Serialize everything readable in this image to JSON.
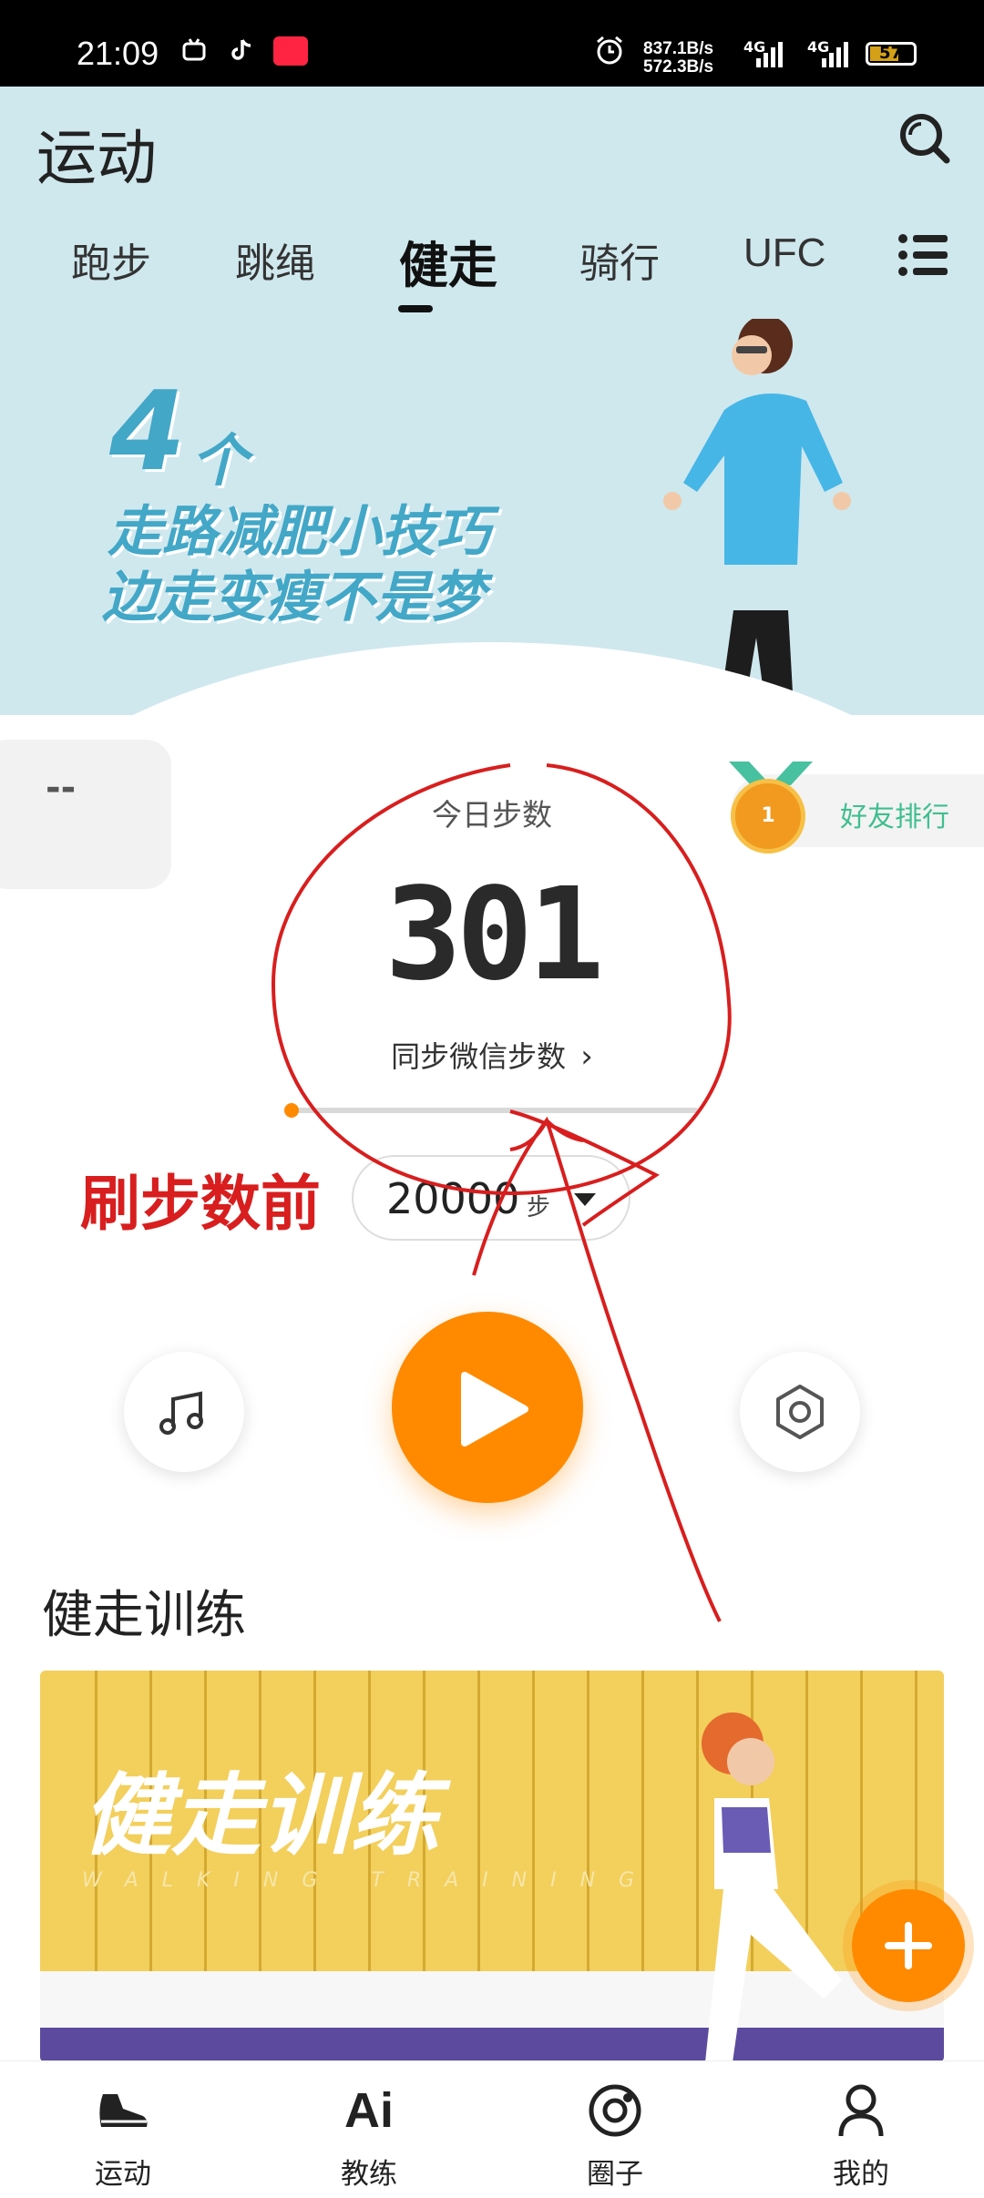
{
  "status_bar": {
    "time": "21:09",
    "net_up": "837.1B/s",
    "net_down": "572.3B/s",
    "signal1": "4G",
    "signal2": "4G",
    "battery": "57"
  },
  "header": {
    "title": "运动",
    "tabs": [
      "跑步",
      "跳绳",
      "健走",
      "骑行",
      "UFC"
    ],
    "active_tab": "健走",
    "banner": {
      "number": "4",
      "unit": "个",
      "line1": "走路减肥小技巧",
      "line2": "边走变瘦不是梦"
    }
  },
  "left_card": {
    "value": "--"
  },
  "ranking": {
    "label": "好友排行",
    "medal": "1"
  },
  "steps": {
    "label": "今日步数",
    "value": "301",
    "sync_label": "同步微信步数",
    "progress": 0.015
  },
  "goal": {
    "value": "20000",
    "unit": "步"
  },
  "annotation": {
    "text": "刷步数前"
  },
  "training": {
    "section_title": "健走训练",
    "card_title": "健走训练",
    "card_subtitle": "WALKING TRAINING"
  },
  "bottom_nav": {
    "items": [
      {
        "label": "运动"
      },
      {
        "label": "教练",
        "icon_text": "Ai"
      },
      {
        "label": "圈子"
      },
      {
        "label": "我的"
      }
    ]
  },
  "colors": {
    "accent": "#ff8a00",
    "rank_green": "#3fbf8f",
    "banner_bg": "#cfe8ee",
    "annotation_red": "#d81e1e"
  }
}
